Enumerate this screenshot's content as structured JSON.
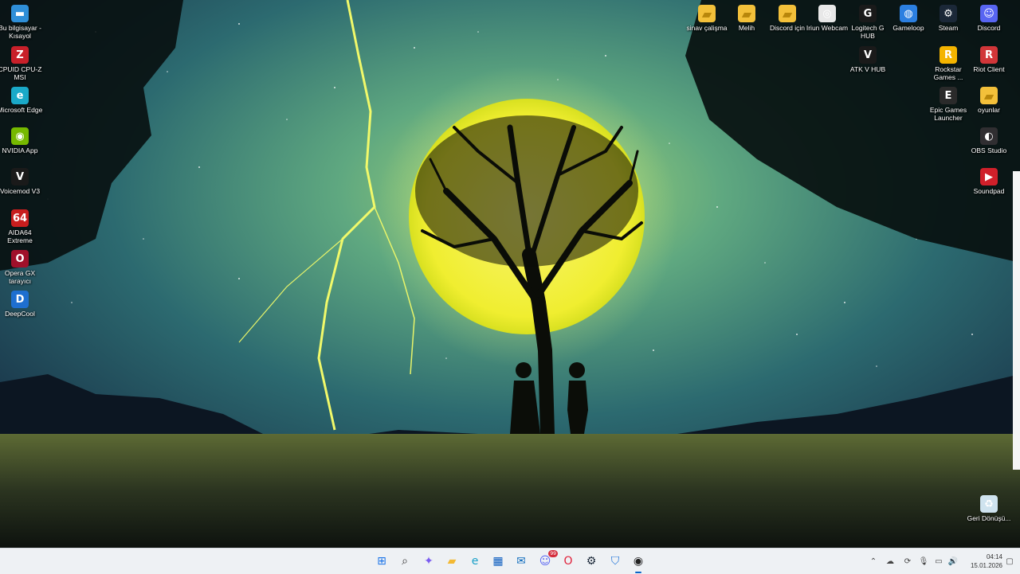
{
  "desktop_icons_left": [
    {
      "label": "Bu bilgisayar - Kısayol",
      "icon": "this-pc-icon",
      "color": "#2f8fd8",
      "glyph": "▬"
    },
    {
      "label": "CPUID CPU-Z MSI",
      "icon": "cpuz-icon",
      "color": "#c8202a",
      "glyph": "Z"
    },
    {
      "label": "Microsoft Edge",
      "icon": "edge-icon",
      "color": "#1aa9c8",
      "glyph": "e"
    },
    {
      "label": "NVIDIA App",
      "icon": "nvidia-icon",
      "color": "#76b900",
      "glyph": "◉"
    },
    {
      "label": "Voicemod V3",
      "icon": "voicemod-icon",
      "color": "#1a1a1a",
      "glyph": "V"
    },
    {
      "label": "AIDA64 Extreme",
      "icon": "aida64-icon",
      "color": "#c81e1e",
      "glyph": "64"
    },
    {
      "label": "Opera GX tarayıcı",
      "icon": "opera-gx-icon",
      "color": "#a0102a",
      "glyph": "O"
    },
    {
      "label": "DeepCool",
      "icon": "deepcool-icon",
      "color": "#1e6fd0",
      "glyph": "D"
    }
  ],
  "desktop_icons_top": [
    {
      "label": "sinav çalişma",
      "icon": "folder-icon",
      "color": "#f3c03a",
      "glyph": "▰"
    },
    {
      "label": "Melih",
      "icon": "folder-icon",
      "color": "#f3c03a",
      "glyph": "▰"
    },
    {
      "label": "Discord için",
      "icon": "folder-icon",
      "color": "#f3c03a",
      "glyph": "▰"
    },
    {
      "label": "Iriun Webcam",
      "icon": "webcam-icon",
      "color": "#e8e8e8",
      "glyph": "◎"
    },
    {
      "label": "Logitech G HUB",
      "icon": "logitech-icon",
      "color": "#1a1a1a",
      "glyph": "G"
    },
    {
      "label": "Gameloop",
      "icon": "gameloop-icon",
      "color": "#2c7fe0",
      "glyph": "◍"
    },
    {
      "label": "Steam",
      "icon": "steam-icon",
      "color": "#1b2838",
      "glyph": "⚙"
    },
    {
      "label": "Discord",
      "icon": "discord-icon",
      "color": "#5865f2",
      "glyph": "☺"
    }
  ],
  "desktop_icons_right": [
    {
      "label": "ATK V HUB",
      "icon": "atk-icon",
      "color": "#1a1a1a",
      "glyph": "V"
    },
    {
      "label": "Rockstar Games ...",
      "icon": "rockstar-icon",
      "color": "#f4b400",
      "glyph": "R"
    },
    {
      "label": "Riot Client",
      "icon": "riot-icon",
      "color": "#d13639",
      "glyph": "R"
    },
    {
      "label": "Epic Games Launcher",
      "icon": "epic-icon",
      "color": "#2a2a2a",
      "glyph": "E"
    },
    {
      "label": "oyunlar",
      "icon": "folder-icon",
      "color": "#f3c03a",
      "glyph": "▰"
    },
    {
      "label": "OBS Studio",
      "icon": "obs-icon",
      "color": "#302e31",
      "glyph": "◐"
    },
    {
      "label": "Soundpad",
      "icon": "soundpad-icon",
      "color": "#d0202a",
      "glyph": "▶"
    },
    {
      "label": "Geri Dönüşü...",
      "icon": "recycle-bin-icon",
      "color": "#cfe3ef",
      "glyph": "♻"
    }
  ],
  "taskbar": {
    "apps": [
      {
        "name": "start-icon",
        "glyph": "⊞",
        "color": "#1a73e8"
      },
      {
        "name": "search-icon",
        "glyph": "⌕",
        "color": "#333"
      },
      {
        "name": "copilot-icon",
        "glyph": "✦",
        "color": "#7b5cf0"
      },
      {
        "name": "file-explorer-icon",
        "glyph": "▰",
        "color": "#f3b933"
      },
      {
        "name": "edge-icon",
        "glyph": "e",
        "color": "#1aa0c8"
      },
      {
        "name": "store-icon",
        "glyph": "▦",
        "color": "#0a5cbf"
      },
      {
        "name": "outlook-icon",
        "glyph": "✉",
        "color": "#0f6cbd"
      },
      {
        "name": "discord-icon",
        "glyph": "☺",
        "color": "#5865f2"
      },
      {
        "name": "opera-icon",
        "glyph": "O",
        "color": "#e0203a"
      },
      {
        "name": "steam-icon",
        "glyph": "⚙",
        "color": "#1b2838"
      },
      {
        "name": "vpn-shield-icon",
        "glyph": "⛉",
        "color": "#1e73d8"
      },
      {
        "name": "app-icon",
        "glyph": "◉",
        "color": "#222"
      }
    ],
    "discord_badge": "99",
    "clock": {
      "time": "04:14",
      "date": "15.01.2026"
    }
  }
}
